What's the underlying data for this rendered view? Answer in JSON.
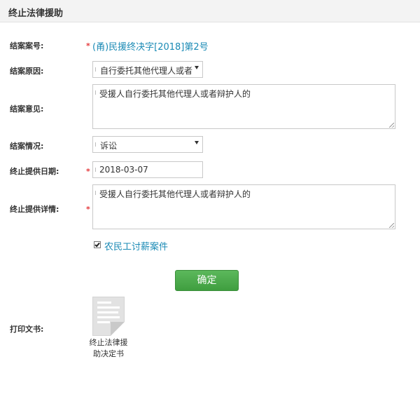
{
  "header": {
    "title": "终止法律援助"
  },
  "form": {
    "case_no": {
      "label": "结案案号:",
      "value": "(甬)民援终决字[2018]第2号"
    },
    "reason": {
      "label": "结案原因:",
      "value": "自行委托其他代理人或者辩护人的"
    },
    "opinion": {
      "label": "结案意见:",
      "value": "受援人自行委托其他代理人或者辩护人的"
    },
    "situation": {
      "label": "结案情况:",
      "value": "诉讼"
    },
    "end_date": {
      "label": "终止提供日期:",
      "value": "2018-03-07"
    },
    "end_detail": {
      "label": "终止提供详情:",
      "value": "受援人自行委托其他代理人或者辩护人的"
    },
    "migrant_wage": {
      "label": "农民工讨薪案件",
      "checked": true
    },
    "required_mark": "*"
  },
  "actions": {
    "confirm_label": "确定"
  },
  "print": {
    "label": "打印文书:",
    "document_line1": "终止法律援",
    "document_line2": "助决定书",
    "document_icon": "document-icon"
  }
}
